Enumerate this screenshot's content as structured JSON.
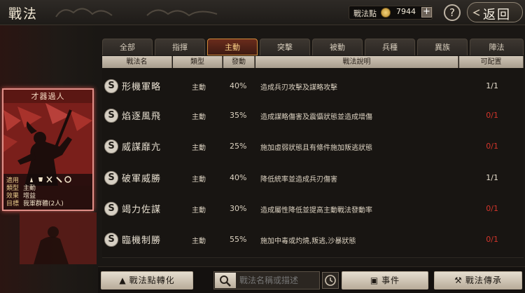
{
  "header": {
    "title": "戰法",
    "points_label": "戰法點",
    "points_value": "7944",
    "plus_label": "+",
    "help_label": "?",
    "back_label": "返回"
  },
  "tabs": [
    {
      "label": "全部"
    },
    {
      "label": "指揮"
    },
    {
      "label": "主動"
    },
    {
      "label": "突擊"
    },
    {
      "label": "被動"
    },
    {
      "label": "兵種"
    },
    {
      "label": "異族"
    },
    {
      "label": "陣法"
    }
  ],
  "active_tab": "主動",
  "columns": [
    "戰法名",
    "類型",
    "發動",
    "戰法說明",
    "可配置"
  ],
  "rows": [
    {
      "name": "形機軍略",
      "type": "主動",
      "rate": "40%",
      "desc": "造成兵刃攻擊及謀略攻擊",
      "count": "1/1",
      "available": true
    },
    {
      "name": "焰逐風飛",
      "type": "主動",
      "rate": "35%",
      "desc": "造成謀略傷害及震懾狀態並造成增傷",
      "count": "0/1",
      "available": false
    },
    {
      "name": "威謀靡亢",
      "type": "主動",
      "rate": "25%",
      "desc": "施加虛弱狀態且有條件施加叛逃狀態",
      "count": "0/1",
      "available": false
    },
    {
      "name": "破軍威勝",
      "type": "主動",
      "rate": "40%",
      "desc": "降低統率並造成兵刃傷害",
      "count": "1/1",
      "available": true
    },
    {
      "name": "竭力佐謀",
      "type": "主動",
      "rate": "30%",
      "desc": "造成屬性降低並提高主動戰法發動率",
      "count": "0/1",
      "available": false
    },
    {
      "name": "臨機制勝",
      "type": "主動",
      "rate": "55%",
      "desc": "施加中毒或灼燒,叛逃,沙暴狀態",
      "count": "0/1",
      "available": false
    }
  ],
  "selected_card": {
    "title": "才器過人",
    "info": [
      {
        "key": "適用",
        "value": ""
      },
      {
        "key": "類型",
        "value": "主動"
      },
      {
        "key": "效果",
        "value": "增益"
      },
      {
        "key": "目標",
        "value": "我軍群體(2人)"
      }
    ]
  },
  "bottom": {
    "convert_label": "戰法點轉化",
    "search_placeholder": "戰法名稱或描述",
    "events_label": "事件",
    "inherit_label": "戰法傳承"
  },
  "colors": {
    "accent_red": "#d2352b",
    "active_tab": "#d28a3a",
    "card_border": "#e08f88"
  }
}
